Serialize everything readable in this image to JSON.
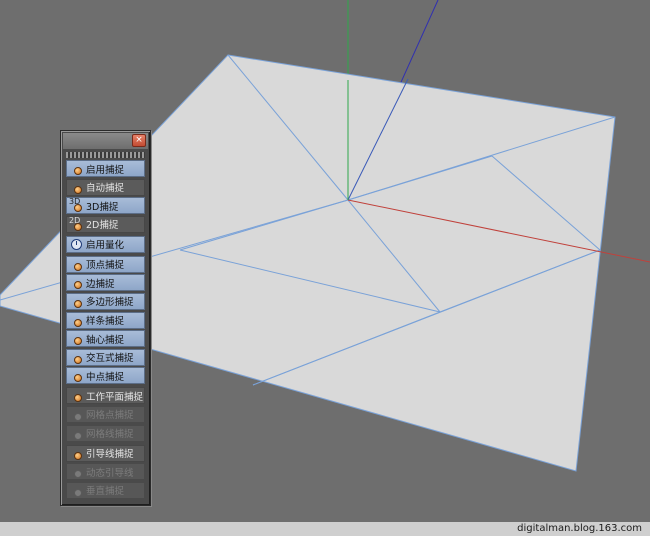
{
  "palette": {
    "close_glyph": "×",
    "items": [
      {
        "label": "启用捕捉",
        "state": "on",
        "icon": "snap-toggle-icon"
      },
      {
        "label": "自动捕捉",
        "state": "off",
        "icon": "auto-snap-icon"
      },
      {
        "label": "3D捕捉",
        "state": "on",
        "icon": "3d-snap-icon",
        "glyph": "3D"
      },
      {
        "label": "2D捕捉",
        "state": "off",
        "icon": "2d-snap-icon",
        "glyph": "2D"
      },
      {
        "label": "启用量化",
        "state": "on",
        "icon": "quantize-clock-icon",
        "gap": true
      },
      {
        "label": "顶点捕捉",
        "state": "on",
        "icon": "vertex-snap-icon",
        "gap": true
      },
      {
        "label": "边捕捉",
        "state": "on",
        "icon": "edge-snap-icon"
      },
      {
        "label": "多边形捕捉",
        "state": "on",
        "icon": "polygon-snap-icon"
      },
      {
        "label": "样条捕捉",
        "state": "on",
        "icon": "spline-snap-icon"
      },
      {
        "label": "轴心捕捉",
        "state": "on",
        "icon": "axis-snap-icon"
      },
      {
        "label": "交互式捕捉",
        "state": "on",
        "icon": "intersection-snap-icon"
      },
      {
        "label": "中点捕捉",
        "state": "on",
        "icon": "midpoint-snap-icon"
      },
      {
        "label": "工作平面捕捉",
        "state": "off",
        "icon": "workplane-snap-icon",
        "gap": true
      },
      {
        "label": "网格点捕捉",
        "state": "disabled",
        "icon": "grid-point-snap-icon"
      },
      {
        "label": "网格线捕捉",
        "state": "disabled",
        "icon": "grid-line-snap-icon"
      },
      {
        "label": "引导线捕捉",
        "state": "off",
        "icon": "guide-snap-icon",
        "gap": true
      },
      {
        "label": "动态引导线",
        "state": "disabled",
        "icon": "dynamic-guide-icon"
      },
      {
        "label": "垂直捕捉",
        "state": "disabled",
        "icon": "perpendicular-snap-icon"
      }
    ]
  },
  "watermark": "digitalman.blog.163.com",
  "colors": {
    "background": "#6e6e6e",
    "plane": "#d9d9d9",
    "edge": "#7aa2d8",
    "axis_x": "#c0413b",
    "axis_y": "#2fa84a",
    "axis_z": "#3030b0",
    "active_item": "#9bb2d2"
  }
}
